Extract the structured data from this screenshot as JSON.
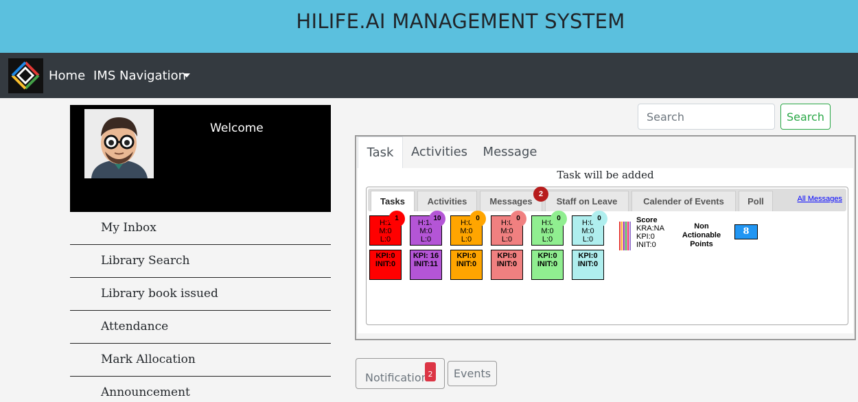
{
  "header": {
    "title": "HILIFE.AI MANAGEMENT SYSTEM"
  },
  "navbar": {
    "home": "Home",
    "ims_navigation": "IMS Navigation"
  },
  "profile": {
    "welcome": "Welcome"
  },
  "sidebar": {
    "items": [
      {
        "label": "My Inbox"
      },
      {
        "label": "Library Search"
      },
      {
        "label": "Library book issued"
      },
      {
        "label": "Attendance"
      },
      {
        "label": "Mark Allocation"
      },
      {
        "label": "Announcement"
      }
    ]
  },
  "search": {
    "placeholder": "Search",
    "button": "Search"
  },
  "main_tabs": {
    "tabs": [
      {
        "label": "Task"
      },
      {
        "label": "Activities"
      },
      {
        "label": "Message"
      }
    ],
    "active": "Task",
    "message": "Task will be added"
  },
  "dashboard": {
    "tabs": [
      {
        "label": "Tasks"
      },
      {
        "label": "Activities"
      },
      {
        "label": "Messages"
      },
      {
        "label": "Staff on Leave"
      },
      {
        "label": "Calender of Events"
      },
      {
        "label": "Poll"
      }
    ],
    "messages_badge": "2",
    "all_messages": "All Messages",
    "cards": [
      {
        "color": "#ff0000",
        "h": "H:1",
        "m": "M:0",
        "l": "L:0",
        "badge": "1",
        "badge_color": "#ff0000",
        "kpi": "KPI:0",
        "init": "INIT:0"
      },
      {
        "color": "#b455d6",
        "h": "H:10",
        "m": "M:0",
        "l": "L:0",
        "badge": "10",
        "badge_color": "#b455d6",
        "kpi": "KPI: 16",
        "init": "INIT:11"
      },
      {
        "color": "#ffa500",
        "h": "H:0",
        "m": "M:0",
        "l": "L:0",
        "badge": "0",
        "badge_color": "#ffa500",
        "kpi": "KPI:0",
        "init": "INIT:0"
      },
      {
        "color": "#f08080",
        "h": "H:0",
        "m": "M:0",
        "l": "L:0",
        "badge": "0",
        "badge_color": "#f08080",
        "kpi": "KPI:0",
        "init": "INIT:0"
      },
      {
        "color": "#90ee90",
        "h": "H:0",
        "m": "M:0",
        "l": "L:0",
        "badge": "0",
        "badge_color": "#90ee90",
        "kpi": "KPI:0",
        "init": "INIT:0"
      },
      {
        "color": "#afeeee",
        "h": "H:0",
        "m": "M:0",
        "l": "L:0",
        "badge": "0",
        "badge_color": "#afeeee",
        "kpi": "KPI:0",
        "init": "INIT:0"
      }
    ],
    "score": {
      "title": "Score",
      "kra": "KRA:NA",
      "kpi": "KPI:0",
      "init": "INIT:0"
    },
    "non_actionable": {
      "label": "Non Actionable Points",
      "value": "8"
    }
  },
  "bottom_tabs": {
    "notification": "Notification",
    "notification_count": "2",
    "events": "Events"
  }
}
